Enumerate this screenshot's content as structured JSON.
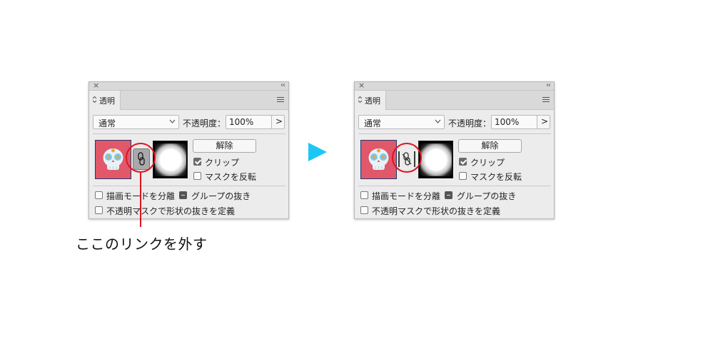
{
  "panel_before": {
    "close_glyph": "×",
    "collapse_glyph": "‹‹",
    "tab": {
      "arrows": "⌃⌄",
      "label": "透明"
    },
    "blend_mode": "通常",
    "opacity_label": "不透明度：",
    "opacity_value": "100%",
    "opacity_arrow": ">",
    "release_label": "解除",
    "clip_label": "クリップ",
    "clip_checked": true,
    "invert_label": "マスクを反転",
    "invert_checked": false,
    "isolate_label": "描画モードを分離",
    "knockout_label": "グループの抜き",
    "define_knockout_label": "不透明マスクで形状の抜きを定義",
    "link_state": "linked",
    "link_icon": "link-icon"
  },
  "panel_after": {
    "close_glyph": "×",
    "collapse_glyph": "‹‹",
    "tab": {
      "arrows": "⌃⌄",
      "label": "透明"
    },
    "blend_mode": "通常",
    "opacity_label": "不透明度：",
    "opacity_value": "100%",
    "opacity_arrow": ">",
    "release_label": "解除",
    "clip_label": "クリップ",
    "clip_checked": true,
    "invert_label": "マスクを反転",
    "invert_checked": false,
    "isolate_label": "描画モードを分離",
    "knockout_label": "グループの抜き",
    "define_knockout_label": "不透明マスクで形状の抜きを定義",
    "link_state": "unlinked",
    "link_icon": "unlink-icon"
  },
  "annotation": {
    "callout": "ここのリンクを外す",
    "highlight_color": "#e0141e",
    "arrow_color": "#1bc8f5"
  },
  "colors": {
    "art_background": "#e0586a",
    "panel_background": "#ececec"
  }
}
